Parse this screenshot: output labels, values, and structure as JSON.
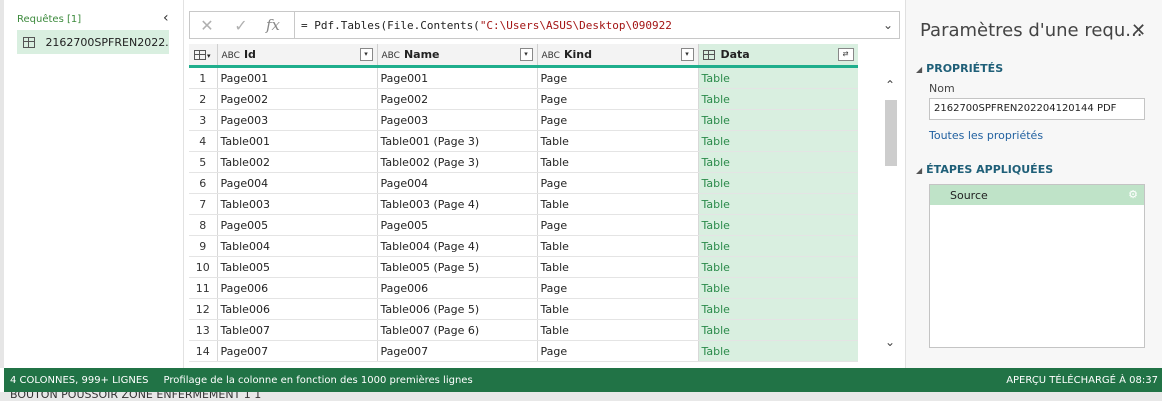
{
  "queries": {
    "title": "Requêtes [1]",
    "collapse_icon": "chevron-left-icon",
    "items": [
      {
        "label": "2162700SPFREN2022..."
      }
    ]
  },
  "formula": {
    "cancel_icon": "✕",
    "commit_icon": "✓",
    "fx": "fx",
    "prefix": "= Pdf.Tables(File.Contents(",
    "string": "\"C:\\Users\\ASUS\\Desktop\\090922"
  },
  "grid": {
    "columns": [
      {
        "type": "ABC",
        "name": "Id"
      },
      {
        "type": "ABC",
        "name": "Name"
      },
      {
        "type": "ABC",
        "name": "Kind"
      },
      {
        "type": "table",
        "name": "Data"
      }
    ],
    "rows": [
      {
        "n": "1",
        "id": "Page001",
        "name": "Page001",
        "kind": "Page",
        "data": "Table"
      },
      {
        "n": "2",
        "id": "Page002",
        "name": "Page002",
        "kind": "Page",
        "data": "Table"
      },
      {
        "n": "3",
        "id": "Page003",
        "name": "Page003",
        "kind": "Page",
        "data": "Table"
      },
      {
        "n": "4",
        "id": "Table001",
        "name": "Table001 (Page 3)",
        "kind": "Table",
        "data": "Table"
      },
      {
        "n": "5",
        "id": "Table002",
        "name": "Table002 (Page 3)",
        "kind": "Table",
        "data": "Table"
      },
      {
        "n": "6",
        "id": "Page004",
        "name": "Page004",
        "kind": "Page",
        "data": "Table"
      },
      {
        "n": "7",
        "id": "Table003",
        "name": "Table003 (Page 4)",
        "kind": "Table",
        "data": "Table"
      },
      {
        "n": "8",
        "id": "Page005",
        "name": "Page005",
        "kind": "Page",
        "data": "Table"
      },
      {
        "n": "9",
        "id": "Table004",
        "name": "Table004 (Page 4)",
        "kind": "Table",
        "data": "Table"
      },
      {
        "n": "10",
        "id": "Table005",
        "name": "Table005 (Page 5)",
        "kind": "Table",
        "data": "Table"
      },
      {
        "n": "11",
        "id": "Page006",
        "name": "Page006",
        "kind": "Page",
        "data": "Table"
      },
      {
        "n": "12",
        "id": "Table006",
        "name": "Table006 (Page 5)",
        "kind": "Table",
        "data": "Table"
      },
      {
        "n": "13",
        "id": "Table007",
        "name": "Table007 (Page 6)",
        "kind": "Table",
        "data": "Table"
      },
      {
        "n": "14",
        "id": "Page007",
        "name": "Page007",
        "kind": "Page",
        "data": "Table"
      }
    ]
  },
  "settings": {
    "title": "Paramètres d'une requ...",
    "properties_header": "PROPRIÉTÉS",
    "name_label": "Nom",
    "name_value": "2162700SPFREN202204120144 PDF",
    "all_properties_link": "Toutes les propriétés",
    "steps_header": "ÉTAPES APPLIQUÉES",
    "steps": [
      {
        "label": "Source"
      }
    ]
  },
  "status": {
    "summary": "4 COLONNES, 999+ LIGNES",
    "profiling": "Profilage de la colonne en fonction des 1000 premières lignes",
    "preview": "APERÇU TÉLÉCHARGÉ À 08:37"
  },
  "background": {
    "text": "BOUTON POUSSOIR ZONE ENFERMEMENT 1   1"
  }
}
